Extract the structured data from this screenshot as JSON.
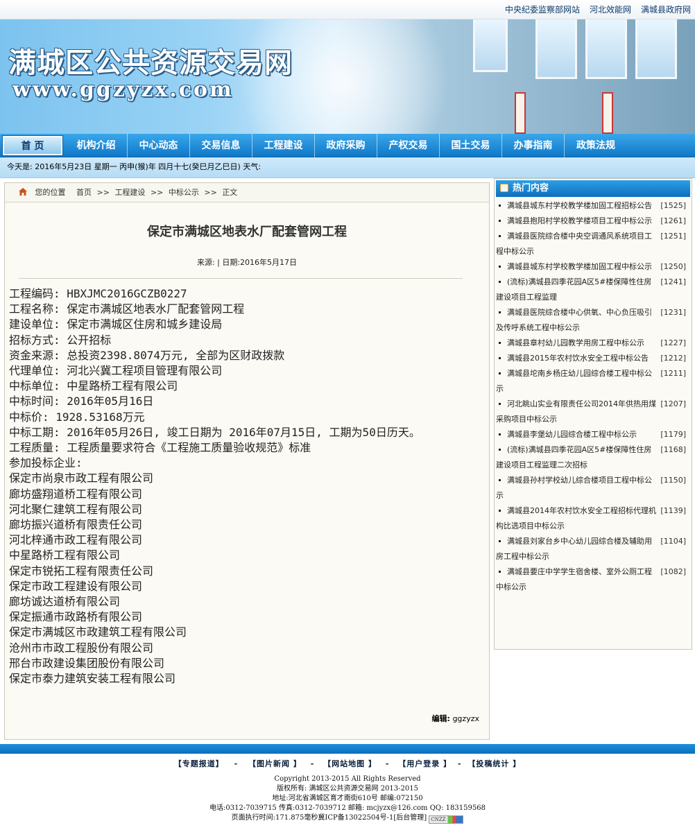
{
  "top_links": [
    "中央纪委监察部网站",
    "河北效能网",
    "满城县政府网"
  ],
  "banner": {
    "title": "满城区公共资源交易网",
    "url": "www.ggzyzx.com"
  },
  "nav": [
    "首 页",
    "机构介绍",
    "中心动态",
    "交易信息",
    "工程建设",
    "政府采购",
    "产权交易",
    "国土交易",
    "办事指南",
    "政策法规"
  ],
  "datebar": "今天是: 2016年5月23日 星期一 丙申(猴)年 四月十七(癸巳月乙巳日)  天气:",
  "breadcrumb": [
    "您的位置",
    "首页",
    ">>",
    "工程建设",
    ">>",
    "中标公示",
    ">>",
    "正文"
  ],
  "article": {
    "title": "保定市满城区地表水厂配套管网工程",
    "meta": "来源:  | 日期:2016年5月17日",
    "lines": [
      "工程编码: HBXJMC2016GCZB0227",
      "工程名称: 保定市满城区地表水厂配套管网工程",
      "建设单位: 保定市满城区住房和城乡建设局",
      "招标方式: 公开招标",
      "资金来源: 总投资2398.8074万元, 全部为区财政拨款",
      "代理单位: 河北兴冀工程项目管理有限公司",
      "中标单位: 中星路桥工程有限公司",
      "中标时间: 2016年05月16日",
      "中标价: 1928.53168万元",
      "中标工期: 2016年05月26日, 竣工日期为 2016年07月15日, 工期为50日历天。",
      "工程质量: 工程质量要求符合《工程施工质量验收规范》标准",
      "参加投标企业:",
      "保定市尚泉市政工程有限公司",
      "廊坊盛翔道桥工程有限公司",
      "河北聚仁建筑工程有限公司",
      "廊坊振兴道桥有限责任公司",
      "河北梓通市政工程有限公司",
      "中星路桥工程有限公司",
      "保定市锐拓工程有限责任公司",
      "保定市政工程建设有限公司",
      "廊坊诚达道桥有限公司",
      "保定振通市政路桥有限公司",
      "保定市满城区市政建筑工程有限公司",
      "沧州市市政工程股份有限公司",
      "邢台市政建设集团股份有限公司",
      "保定市泰力建筑安装工程有限公司"
    ],
    "editor_label": "编辑:",
    "editor": "ggzyzx"
  },
  "hot": {
    "title": "热门内容",
    "items": [
      {
        "text": "满城县城东村学校教学楼加固工程招标公告",
        "count": "[1525]"
      },
      {
        "text": "满城县抱阳村学校教学楼项目工程中标公示",
        "count": "[1261]"
      },
      {
        "text": "满城县医院综合楼中央空调通风系统项目工程中标公示",
        "count": "[1251]"
      },
      {
        "text": "满城县城东村学校教学楼加固工程中标公示",
        "count": "[1250]"
      },
      {
        "text": "(流标)满城县四季花园A区5#楼保障性住房建设项目工程监理",
        "count": "[1241]"
      },
      {
        "text": "满城县医院综合楼中心供氧、中心负压吸引及传呼系统工程中标公示",
        "count": "[1231]"
      },
      {
        "text": "满城县章村幼儿园教学用房工程中标公示",
        "count": "[1227]"
      },
      {
        "text": "满城县2015年农村饮水安全工程中标公告",
        "count": "[1212]"
      },
      {
        "text": "满城县坨南乡杨庄幼儿园综合楼工程中标公示",
        "count": "[1211]"
      },
      {
        "text": "河北眺山实业有限责任公司2014年供热用煤采购项目中标公示",
        "count": "[1207]"
      },
      {
        "text": "满城县李堡幼儿园综合楼工程中标公示",
        "count": "[1179]"
      },
      {
        "text": "(流标)满城县四季花园A区5#楼保障性住房建设项目工程监理二次招标",
        "count": "[1168]"
      },
      {
        "text": "满城县孙村学校幼儿综合楼项目工程中标公示",
        "count": "[1150]"
      },
      {
        "text": "满城县2014年农村饮水安全工程招标代理机构比选项目中标公示",
        "count": "[1139]"
      },
      {
        "text": "满城县刘家台乡中心幼儿园综合楼及辅助用房工程中标公示",
        "count": "[1104]"
      },
      {
        "text": "满城县要庄中学学生宿舍楼、室外公厕工程中标公示",
        "count": "[1082]"
      }
    ]
  },
  "footer": {
    "links": [
      "【专题报道】",
      "【图片新闻 】",
      "【网站地图 】",
      "【用户登录 】",
      "【投稿统计 】"
    ],
    "sep": "-",
    "copyright": "Copyright 2013-2015 All Rights Reserved",
    "owner": "版权所有: 满城区公共资源交易网 2013-2015",
    "address": "地址:河北省满城区育才南街610号 邮编:072150",
    "contact": "电话:0312-7039715 传真:0312-7039712 邮箱: mcjyzx@126.com QQ: 183159568",
    "exec": "页面执行时间:171.875毫秒冀ICP备13022504号-1[后台管理]",
    "badge": "CNZZ"
  }
}
